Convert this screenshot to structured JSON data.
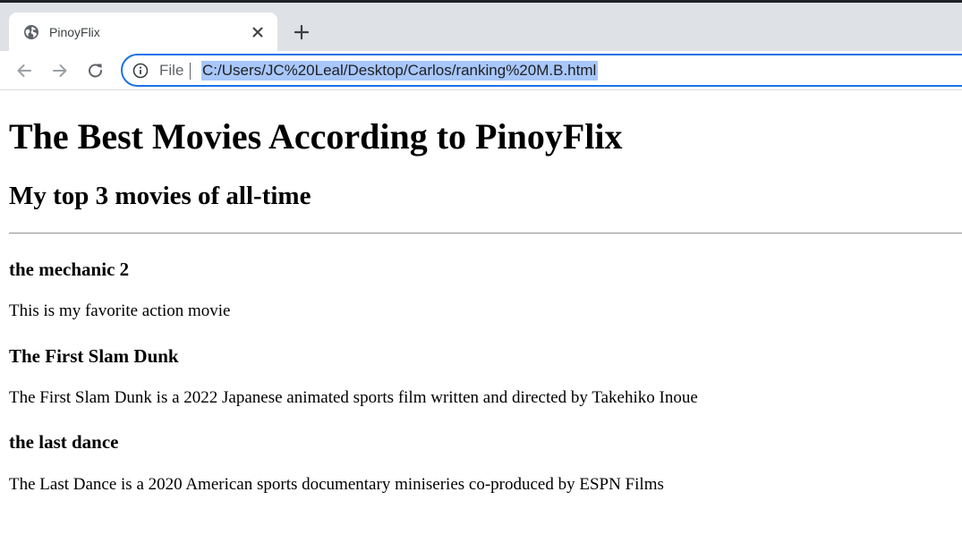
{
  "browser": {
    "tab": {
      "title": "PinoyFlix",
      "favicon": "globe-icon"
    },
    "icons": {
      "close": "close-icon",
      "new_tab": "plus-icon",
      "back": "arrow-left-icon",
      "forward": "arrow-right-icon",
      "reload": "reload-icon",
      "info": "info-icon"
    },
    "address_bar": {
      "scheme_label": "File",
      "url": "C:/Users/JC%20Leal/Desktop/Carlos/ranking%20M.B.html"
    },
    "colors": {
      "accent": "#1a73e8",
      "selection": "#a8c7fa",
      "tabstrip": "#dee1e6"
    }
  },
  "page": {
    "title": "The Best Movies According to PinoyFlix",
    "subtitle": "My top 3 movies of all-time",
    "movies": [
      {
        "title": "the mechanic 2",
        "description": "This is my favorite action movie"
      },
      {
        "title": "The First Slam Dunk",
        "description": "The First Slam Dunk is a 2022 Japanese animated sports film written and directed by Takehiko Inoue"
      },
      {
        "title": "the last dance",
        "description": "The Last Dance is a 2020 American sports documentary miniseries co-produced by ESPN Films"
      }
    ]
  }
}
